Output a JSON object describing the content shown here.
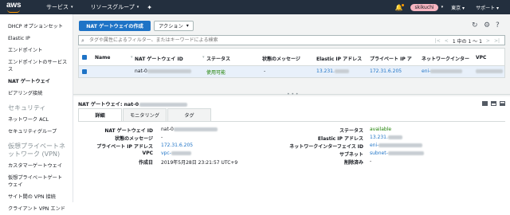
{
  "topbar": {
    "logo": "aws",
    "services": "サービス",
    "resource_groups": "リソースグループ",
    "user": "skikuchi",
    "region": "東京",
    "support": "サポート"
  },
  "sidebar": {
    "items": [
      {
        "label": "DHCP オプションセット",
        "active": false
      },
      {
        "label": "Elastic IP",
        "active": false
      },
      {
        "label": "エンドポイント",
        "active": false
      },
      {
        "label": "エンドポイントのサービス\nス",
        "active": false
      },
      {
        "label": "NAT ゲートウェイ",
        "active": true
      },
      {
        "label": "ピアリング接続",
        "active": false
      }
    ],
    "security_title": "セキュリティ",
    "security_items": [
      "ネットワーク ACL",
      "セキュリティグループ"
    ],
    "vpn_title": "仮想プライベートネ\nットワーク (VPN)",
    "vpn_items": [
      "カスタマーゲートウェイ",
      "仮想プライベートゲート\nウェイ",
      "サイト間の VPN 接続",
      "クライアント VPN エンド"
    ]
  },
  "toolbar": {
    "create_label": "NAT ゲートウェイの作成",
    "actions_label": "アクション"
  },
  "filter": {
    "placeholder": "タグや属性によるフィルター、またはキーワードによる検索",
    "pager_text": "1 中の 1 ～ 1"
  },
  "table": {
    "columns": [
      "Name",
      "NAT ゲートウェイ ID",
      "ステータス",
      "状態のメッセージ",
      "Elastic IP アドレス",
      "プライベート IP ア",
      "ネットワークインター",
      "VPC"
    ],
    "rows": [
      {
        "name": "",
        "nat_id": "nat-0",
        "status": "使用可能",
        "message": "-",
        "eip": "13.231.",
        "private_ip": "172.31.6.205",
        "eni": "eni-",
        "vpc": ""
      }
    ]
  },
  "detail": {
    "title": "NAT ゲートウェイ: nat-0",
    "tabs": [
      "詳細",
      "モニタリング",
      "タグ"
    ],
    "left": [
      {
        "k": "NAT ゲートウェイ ID",
        "v": "nat-0"
      },
      {
        "k": "状態のメッセージ",
        "v": "-"
      },
      {
        "k": "プライベート IP アドレス",
        "v": "172.31.6.205"
      },
      {
        "k": "VPC",
        "v": "vpc-"
      },
      {
        "k": "作成日",
        "v": "2019年5月28日 23:21:57 UTC+9"
      }
    ],
    "right": [
      {
        "k": "ステータス",
        "v": "available"
      },
      {
        "k": "Elastic IP アドレス",
        "v": "13.231."
      },
      {
        "k": "ネットワークインターフェイス ID",
        "v": "eni-"
      },
      {
        "k": "サブネット",
        "v": "subnet-"
      },
      {
        "k": "削除済み",
        "v": "-"
      }
    ]
  },
  "colors": {
    "topbar": "#232f3e",
    "primary": "#1e73c6",
    "success": "#1d8102",
    "selected_row": "#e8f0fa"
  }
}
